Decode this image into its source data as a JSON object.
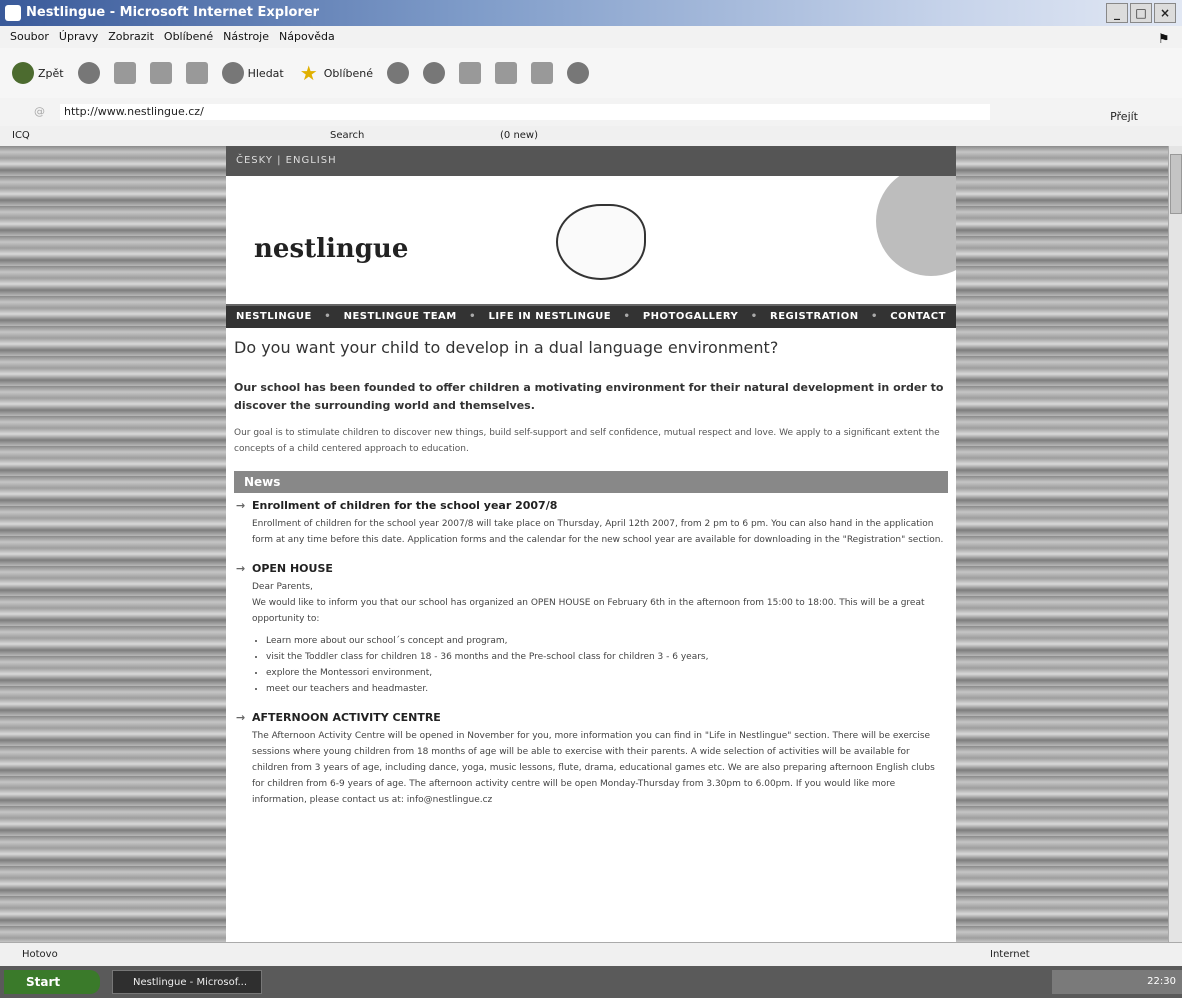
{
  "window": {
    "title": "Nestlingue - Microsoft Internet Explorer"
  },
  "menu": [
    "Soubor",
    "Úpravy",
    "Zobrazit",
    "Oblíbené",
    "Nástroje",
    "Nápověda"
  ],
  "toolbar": {
    "back": "Zpět",
    "search": "Hledat",
    "favorites": "Oblíbené"
  },
  "address": {
    "url": "http://www.nestlingue.cz/",
    "go": "Přejít"
  },
  "icq": {
    "label": "ICQ",
    "search": "Search",
    "mail": "(0 new)"
  },
  "page": {
    "lang": "ČESKY | ENGLISH",
    "logo": "nestlingue",
    "nav": [
      "NESTLINGUE",
      "NESTLINGUE TEAM",
      "LIFE IN NESTLINGUE",
      "PHOTOGALLERY",
      "REGISTRATION",
      "CONTACT"
    ],
    "headline": "Do you want your child to develop in a dual language environment?",
    "intro": "Our school has been founded to offer children a motivating environment for their natural development in order to discover the surrounding world and themselves.",
    "goal": "Our goal is to stimulate children to discover new things, build self-support and self confidence, mutual respect and love. We apply to a significant extent the concepts of a child centered approach to education.",
    "news_label": "News",
    "news": [
      {
        "title": "Enrollment of children for the school year 2007/8",
        "body": "Enrollment of children for the school year 2007/8 will take place on Thursday, April 12th 2007, from 2 pm to 6 pm. You can also hand in the application form at any time before this date. Application forms and the calendar for the new school year are available for downloading in the \"Registration\" section."
      },
      {
        "title": "OPEN HOUSE",
        "greeting": "Dear Parents,",
        "body": "We would like to inform you that our school has organized an OPEN HOUSE on February 6th in the afternoon from 15:00 to 18:00. This will be a great opportunity to:",
        "bullets": [
          "Learn more about our school´s concept and program,",
          "visit the Toddler class for children 18 - 36 months and the Pre-school class for children 3 - 6 years,",
          "explore the Montessori environment,",
          "meet our teachers and headmaster."
        ]
      },
      {
        "title": "AFTERNOON ACTIVITY CENTRE",
        "body": "The Afternoon Activity Centre will be opened in November for you, more information you can find in \"Life in Nestlingue\" section. There will be exercise sessions where young children from 18 months of age will be able to exercise with their parents. A wide selection of activities will be available for children from 3 years of age, including dance, yoga, music lessons, flute, drama, educational games etc. We are also preparing afternoon English clubs for children from 6-9 years of age. The afternoon activity centre will be open Monday-Thursday from 3.30pm to 6.00pm. If you would like more information, please contact us at: info@nestlingue.cz"
      }
    ]
  },
  "status": {
    "left": "Hotovo",
    "zone": "Internet"
  },
  "taskbar": {
    "start": "Start",
    "task": "Nestlingue - Microsof...",
    "clock": "22:30"
  }
}
